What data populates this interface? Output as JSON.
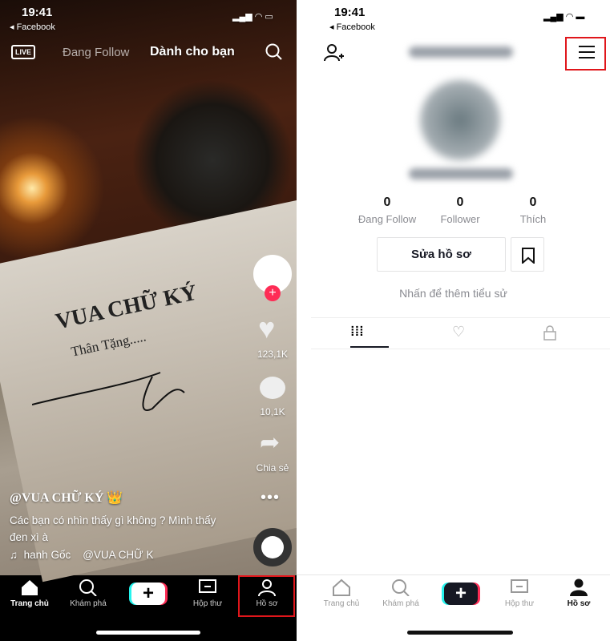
{
  "left": {
    "status": {
      "time": "19:41",
      "back_app": "Facebook"
    },
    "top_tabs": {
      "live": "LIVE",
      "following": "Đang Follow",
      "for_you": "Dành cho bạn"
    },
    "video_text": {
      "title": "VUA CHỮ KÝ",
      "subtitle": "Thân Tặng....."
    },
    "rail": {
      "likes": "123,1K",
      "comments": "10,1K",
      "share": "Chia sẻ"
    },
    "caption": {
      "username": "@VUA CHỮ KÝ 👑",
      "text": "Các bạn có nhìn thấy gì không ? Mình thấy đen xì à",
      "music": "hanh Gốc    @VUA CHỮ K"
    },
    "nav": {
      "home": "Trang chủ",
      "discover": "Khám phá",
      "inbox": "Hộp thư",
      "profile": "Hồ sơ"
    }
  },
  "right": {
    "status": {
      "time": "19:41",
      "back_app": "Facebook"
    },
    "stats": [
      {
        "value": "0",
        "label": "Đang Follow"
      },
      {
        "value": "0",
        "label": "Follower"
      },
      {
        "value": "0",
        "label": "Thích"
      }
    ],
    "edit_profile": "Sửa hồ sơ",
    "bio_hint": "Nhấn để thêm tiểu sử",
    "nav": {
      "home": "Trang chủ",
      "discover": "Khám phá",
      "inbox": "Hộp thư",
      "profile": "Hồ sơ"
    }
  },
  "colors": {
    "highlight": "#e0161b",
    "accent_red": "#fe2c55",
    "accent_cyan": "#25f4ee"
  }
}
